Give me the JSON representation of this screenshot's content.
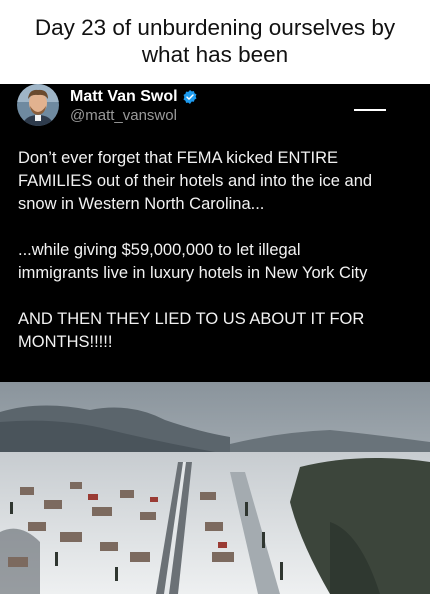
{
  "caption": {
    "line1": "Day 23 of unburdening ourselves by",
    "line2": "what has been"
  },
  "post": {
    "author_name": "Matt Van Swol",
    "handle": "@matt_vanswol",
    "verified": true,
    "paragraphs": [
      [
        "Don’t ever forget that FEMA kicked ENTIRE",
        "FAMILIES out of their hotels and into the ice and",
        "snow in Western North Carolina..."
      ],
      [
        "...while giving $59,000,000 to let illegal",
        "immigrants live in luxury hotels in New York City"
      ],
      [
        "AND THEN THEY LIED TO US ABOUT IT FOR",
        "MONTHS!!!!!"
      ]
    ]
  },
  "icons": {
    "avatar": "avatar-photo",
    "verified": "verified-badge-icon",
    "more": "more-options-icon"
  },
  "colors": {
    "post_background": "#000000",
    "verified_blue": "#1d9bf0",
    "handle_gray": "#9a9a9a"
  },
  "photo": {
    "subject": "aerial-snowy-town-photo"
  }
}
